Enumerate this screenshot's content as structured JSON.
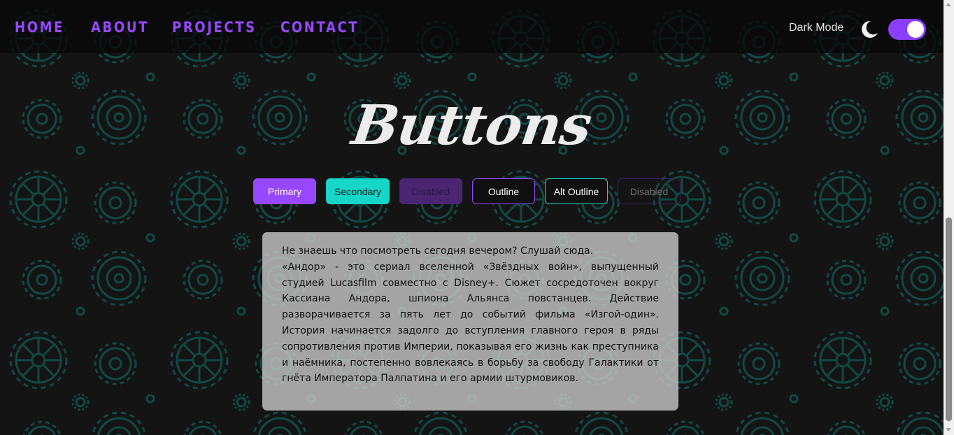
{
  "nav": {
    "links": [
      "HOME",
      "ABOUT",
      "PROJECTS",
      "CONTACT"
    ],
    "dark_mode_label": "Dark Mode",
    "toggle_icon": "moon-icon",
    "dark_mode_on": true
  },
  "hero": {
    "title": "Buttons"
  },
  "buttons": {
    "primary": "Primary",
    "secondary": "Secondary",
    "disabled": "Disabled",
    "outline": "Outline",
    "alt_outline": "Alt Outline",
    "outline_disabled": "Disabled"
  },
  "card": {
    "intro": "Не знаешь что посмотреть сегодня вечером? Слушай сюда.",
    "body": "«Андор» - это сериал вселенной «Звёздных войн», выпущенный студией Lucasfilm совместно с Disney+. Сюжет сосредоточен вокруг Кассиана Андора, шпиона Альянса повстанцев. Действие разворачивается за пять лет до событий фильма «Изгой-один». История начинается задолго до вступления главного героя в ряды сопротивления против Империи, показывая его жизнь как преступника и наёмника, постепенно вовлекаясь в борьбу за свободу Галактики от гнёта Императора Палпатина и его армии штурмовиков."
  },
  "colors": {
    "accent_purple": "#9747ff",
    "accent_teal": "#16d6c7",
    "background": "#141414",
    "gear_pattern": "#0f4a44"
  }
}
